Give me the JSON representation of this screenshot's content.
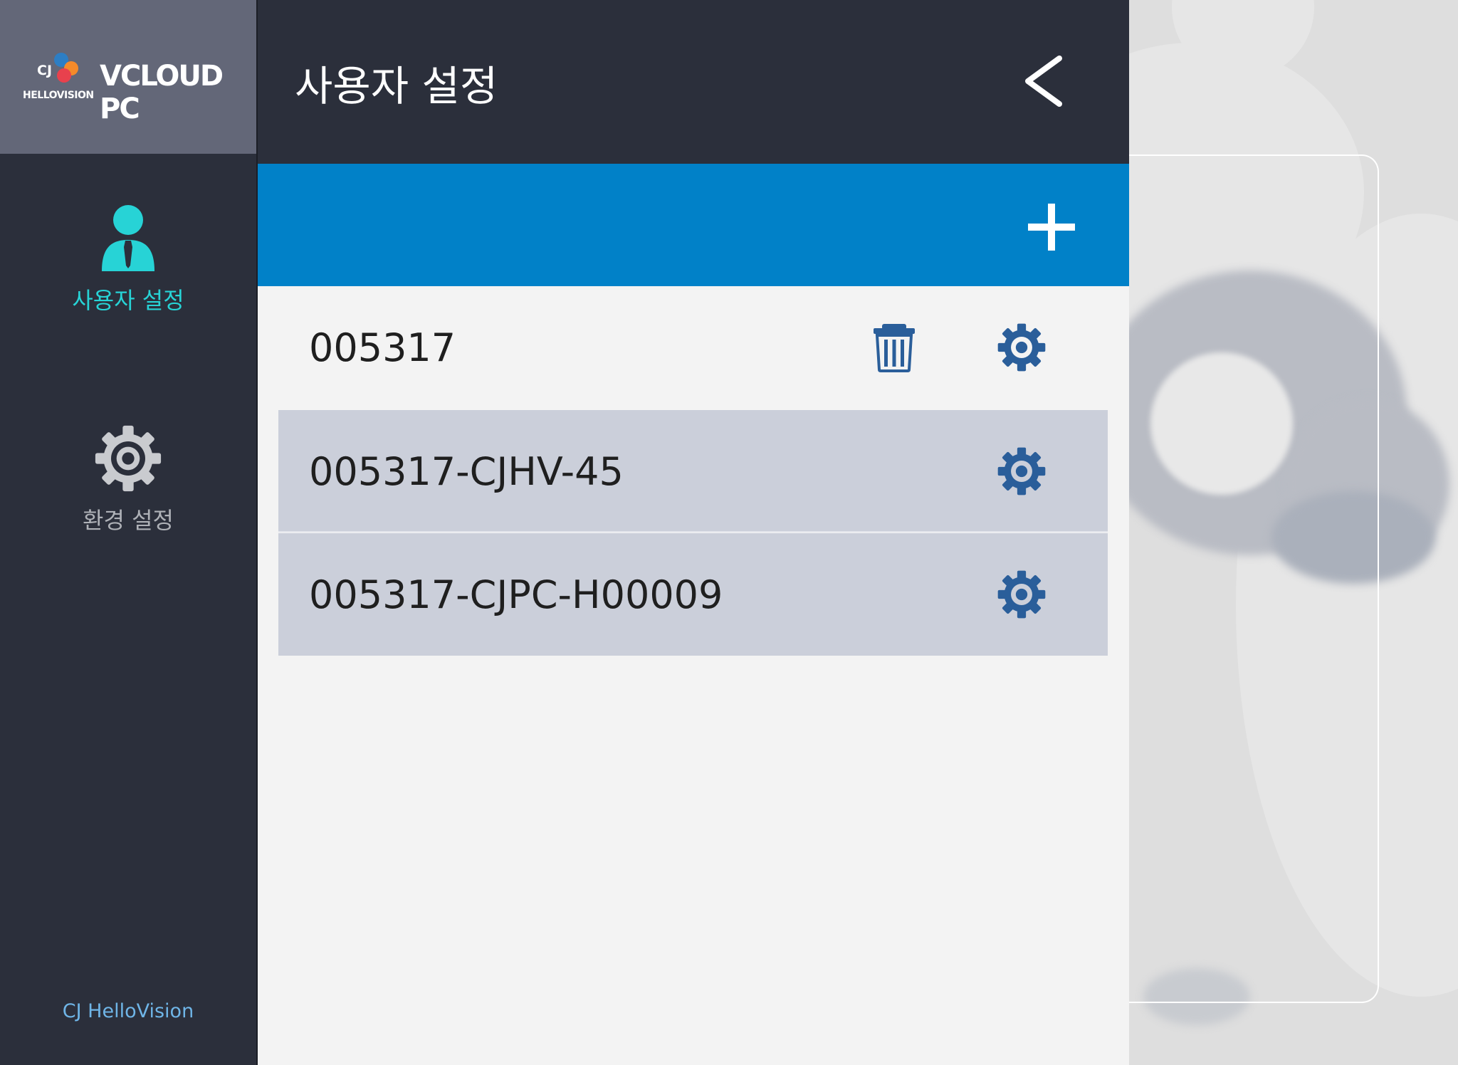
{
  "app": {
    "logo_cj": "CJ",
    "logo_hellovision": "HELLOVISION",
    "logo_product": "VCLOUD PC",
    "footer": "CJ HelloVision"
  },
  "sidebar": {
    "items": [
      {
        "label": "사용자 설정",
        "icon": "user-icon",
        "active": true,
        "color": "#27d3d6"
      },
      {
        "label": "환경 설정",
        "icon": "gear-icon",
        "active": false,
        "color": "#aeb1b7"
      }
    ]
  },
  "header": {
    "title": "사용자 설정",
    "back_icon": "chevron-left-icon"
  },
  "add_bar": {
    "icon": "plus-icon",
    "color": "#0181c8"
  },
  "users": [
    {
      "name": "005317",
      "selected": false,
      "deletable": true
    },
    {
      "name": "005317-CJHV-45",
      "selected": true,
      "deletable": false
    },
    {
      "name": "005317-CJPC-H00009",
      "selected": true,
      "deletable": false
    }
  ],
  "colors": {
    "sidebar_bg": "#2b2f3b",
    "accent": "#0181c8",
    "selected_row": "#cbcfda",
    "action_icon": "#2a5e9a"
  }
}
